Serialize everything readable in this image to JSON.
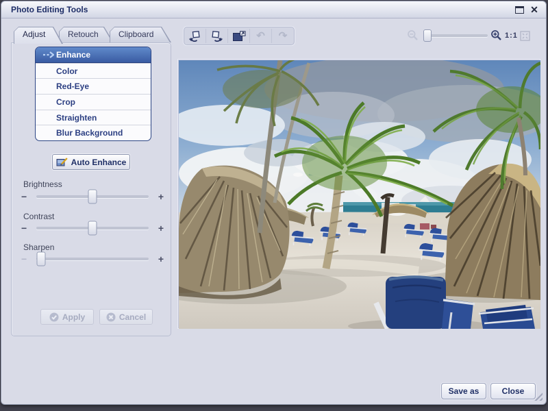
{
  "window": {
    "title": "Photo Editing Tools"
  },
  "tabs": {
    "items": [
      {
        "label": "Adjust",
        "active": true
      },
      {
        "label": "Retouch",
        "active": false
      },
      {
        "label": "Clipboard",
        "active": false
      }
    ]
  },
  "tools": {
    "items": [
      {
        "label": "Enhance",
        "selected": true
      },
      {
        "label": "Color",
        "selected": false
      },
      {
        "label": "Red-Eye",
        "selected": false
      },
      {
        "label": "Crop",
        "selected": false
      },
      {
        "label": "Straighten",
        "selected": false
      },
      {
        "label": "Blur Background",
        "selected": false
      }
    ]
  },
  "buttons": {
    "auto_enhance": "Auto Enhance",
    "apply": "Apply",
    "cancel": "Cancel",
    "save_as": "Save as",
    "close": "Close"
  },
  "sliders": {
    "brightness": {
      "label": "Brightness",
      "value_pct": 50
    },
    "contrast": {
      "label": "Contrast",
      "value_pct": 50
    },
    "sharpen": {
      "label": "Sharpen",
      "value_pct": 4
    }
  },
  "toolbar": {
    "items": [
      {
        "name": "rotate-left",
        "enabled": true
      },
      {
        "name": "rotate-right",
        "enabled": true
      },
      {
        "name": "resize",
        "enabled": true
      },
      {
        "name": "undo",
        "enabled": false
      },
      {
        "name": "redo",
        "enabled": false
      }
    ]
  },
  "zoom": {
    "level_pct": 6,
    "one_to_one": "1:1",
    "zoom_out_enabled": false,
    "zoom_in_enabled": true
  },
  "glyphs": {
    "minus": "−",
    "plus": "+",
    "undo": "↶",
    "redo": "↷",
    "close_window": "✕"
  },
  "colors": {
    "selection_blue_top": "#6089ca",
    "selection_blue_bottom": "#3a5ca3",
    "title_text": "#1d2d66",
    "chair_blue": "#2f549c",
    "panel_bg": "#d9dbe7"
  }
}
